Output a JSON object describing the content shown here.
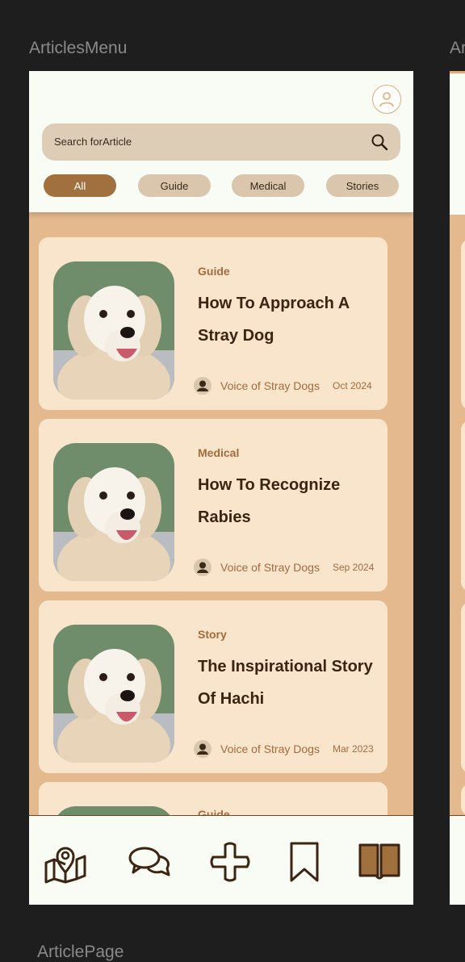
{
  "frames": {
    "main_label": "ArticlesMenu",
    "next_label": "Ar",
    "bottom_label": "ArticlePage"
  },
  "search": {
    "placeholder": "Search forArticle"
  },
  "filters": [
    {
      "label": "All",
      "active": true
    },
    {
      "label": "Guide",
      "active": false
    },
    {
      "label": "Medical",
      "active": false
    },
    {
      "label": "Stories",
      "active": false
    }
  ],
  "articles": [
    {
      "category": "Guide",
      "title": "How To Approach A Stray Dog",
      "author": "Voice of Stray Dogs",
      "date": "Oct 2024"
    },
    {
      "category": "Medical",
      "title": "How To Recognize Rabies",
      "author": "Voice of Stray Dogs",
      "date": "Sep 2024"
    },
    {
      "category": "Story",
      "title": "The Inspirational Story Of Hachi",
      "author": "Voice of Stray Dogs",
      "date": "Mar 2023"
    },
    {
      "category": "Guide",
      "title": "",
      "author": "",
      "date": ""
    }
  ],
  "nav": {
    "items": [
      {
        "icon": "map-pin-icon",
        "active": false
      },
      {
        "icon": "chat-icon",
        "active": false
      },
      {
        "icon": "plus-icon",
        "active": false
      },
      {
        "icon": "bookmark-icon",
        "active": false
      },
      {
        "icon": "book-icon",
        "active": true
      }
    ]
  },
  "colors": {
    "background": "#1e1e1e",
    "list_bg": "#e4b98e",
    "card_bg": "#f8e5cc",
    "accent": "#a0703f",
    "chip_bg": "#d9c6ad",
    "title_text": "#3c2413",
    "meta_text": "#a46b3c"
  }
}
